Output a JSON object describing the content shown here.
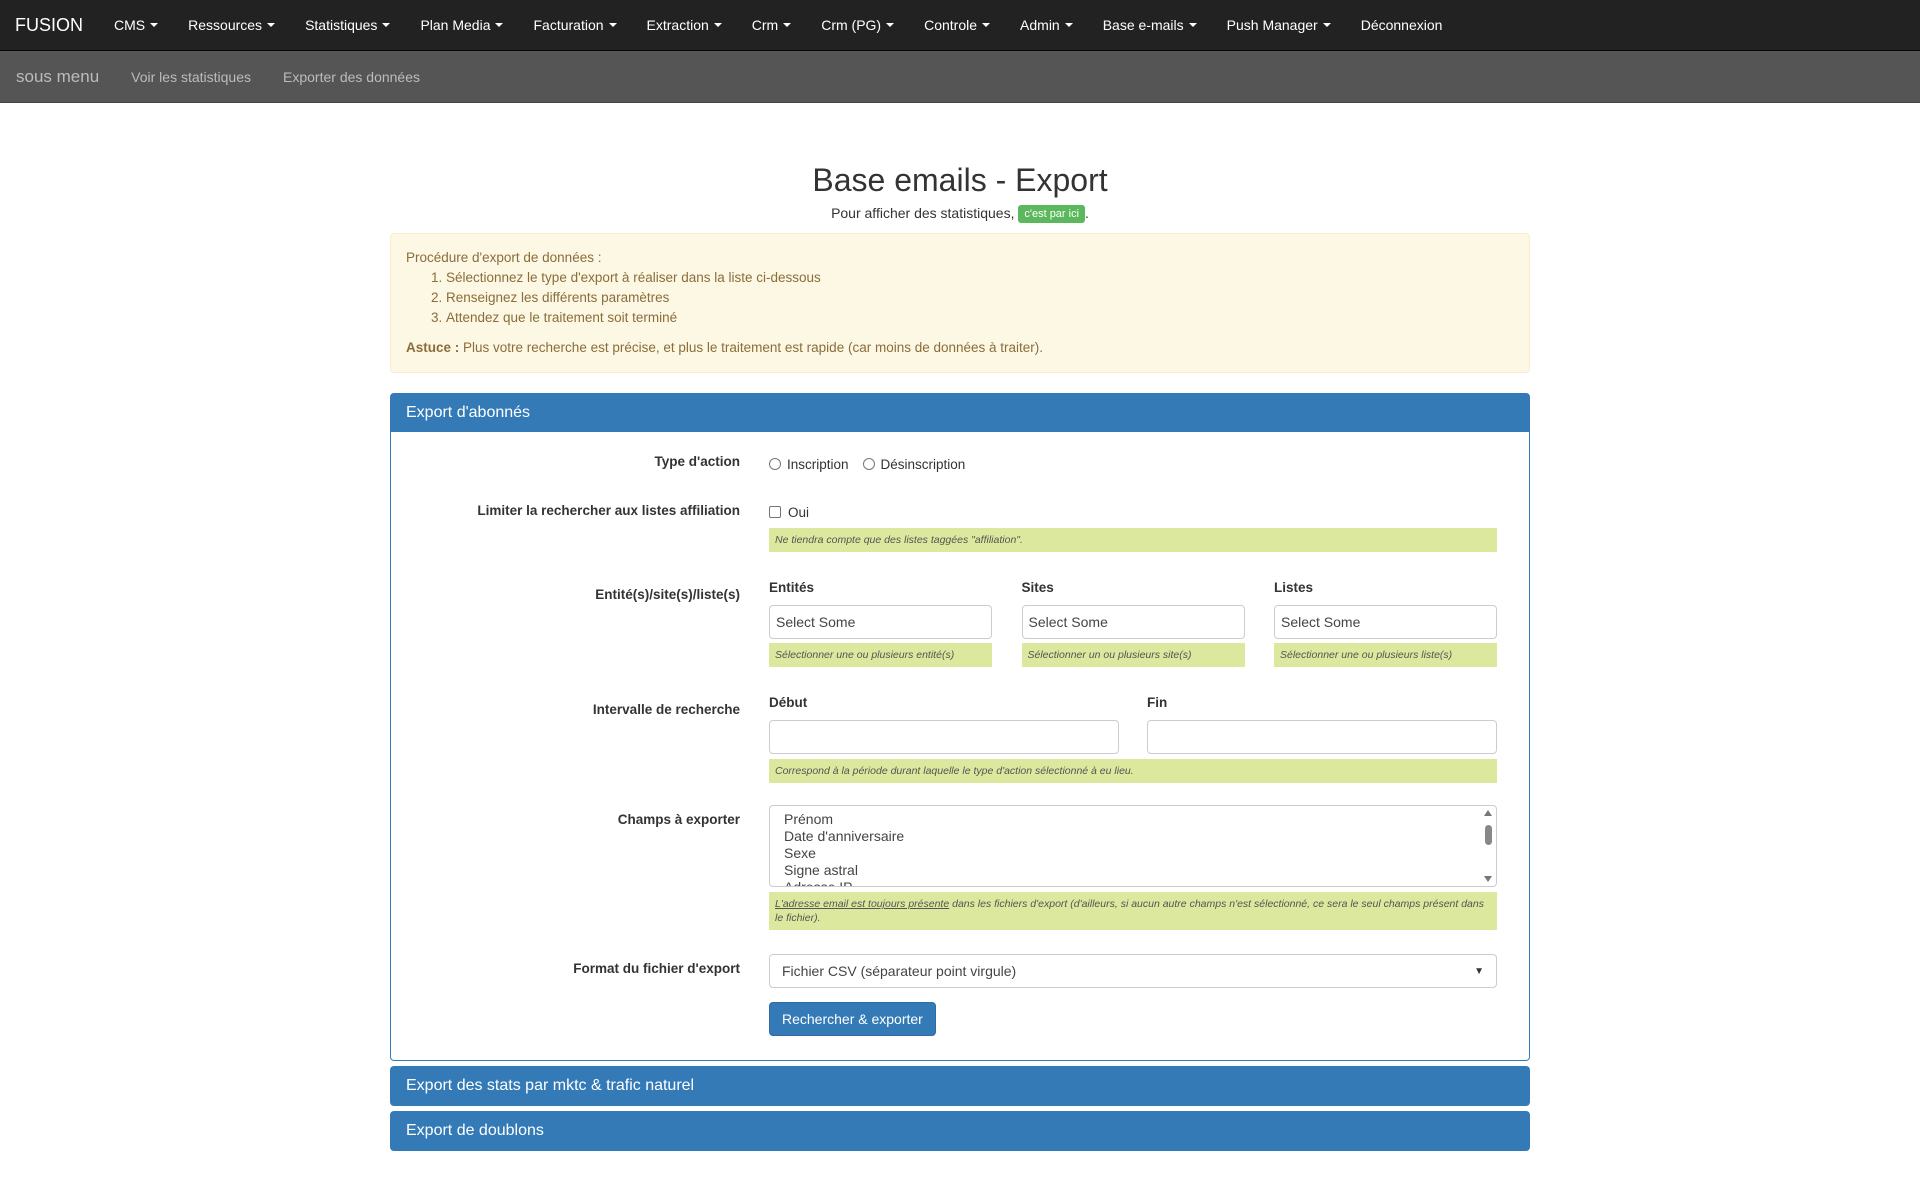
{
  "navbar": {
    "brand": "FUSION",
    "items": [
      {
        "label": "CMS",
        "dropdown": true
      },
      {
        "label": "Ressources",
        "dropdown": true
      },
      {
        "label": "Statistiques",
        "dropdown": true
      },
      {
        "label": "Plan Media",
        "dropdown": true
      },
      {
        "label": "Facturation",
        "dropdown": true
      },
      {
        "label": "Extraction",
        "dropdown": true
      },
      {
        "label": "Crm",
        "dropdown": true
      },
      {
        "label": "Crm (PG)",
        "dropdown": true
      },
      {
        "label": "Controle",
        "dropdown": true
      },
      {
        "label": "Admin",
        "dropdown": true
      },
      {
        "label": "Base e-mails",
        "dropdown": true
      },
      {
        "label": "Push Manager",
        "dropdown": true
      },
      {
        "label": "Déconnexion",
        "dropdown": false
      }
    ]
  },
  "subnav": {
    "title": "sous menu",
    "items": [
      "Voir les statistiques",
      "Exporter des données"
    ]
  },
  "page": {
    "title": "Base emails - Export",
    "intro_text": "Pour afficher des statistiques,",
    "intro_badge": "c'est par ici",
    "intro_suffix": "."
  },
  "alert": {
    "heading": "Procédure d'export de données :",
    "steps": [
      "Sélectionnez le type d'export à réaliser dans la liste ci-dessous",
      "Renseignez les différents paramètres",
      "Attendez que le traitement soit terminé"
    ],
    "tip_label": "Astuce :",
    "tip_text": " Plus votre recherche est précise, et plus le traitement est rapide (car moins de données à traiter)."
  },
  "panel_export": {
    "heading": "Export d'abonnés",
    "action_type": {
      "label": "Type d'action",
      "options": [
        "Inscription",
        "Désinscription"
      ]
    },
    "affiliation": {
      "label": "Limiter la rechercher aux listes affiliation",
      "option": "Oui",
      "help": "Ne tiendra compte que des listes taggées \"affiliation\"."
    },
    "entities": {
      "label": "Entité(s)/site(s)/liste(s)",
      "cols": [
        {
          "title": "Entités",
          "placeholder": "Select Some",
          "help": "Sélectionner une ou plusieurs entité(s)"
        },
        {
          "title": "Sites",
          "placeholder": "Select Some",
          "help": "Sélectionner un ou plusieurs site(s)"
        },
        {
          "title": "Listes",
          "placeholder": "Select Some",
          "help": "Sélectionner une ou plusieurs liste(s)"
        }
      ]
    },
    "interval": {
      "label": "Intervalle de recherche",
      "start_title": "Début",
      "start_value": "",
      "end_title": "Fin",
      "end_value": "",
      "help": "Correspond à la période durant laquelle le type d'action sélectionné à eu lieu."
    },
    "fields": {
      "label": "Champs à exporter",
      "options": [
        "Prénom",
        "Date d'anniversaire",
        "Sexe",
        "Signe astral",
        "Adresse IP"
      ],
      "help_underlined": "L'adresse email est toujours présente",
      "help_rest": " dans les fichiers d'export (d'ailleurs, si aucun autre champs n'est sélectionné, ce sera le seul champs présent dans le fichier)."
    },
    "format": {
      "label": "Format du fichier d'export",
      "selected": "Fichier CSV (séparateur point virgule)"
    },
    "submit_label": "Rechercher & exporter"
  },
  "panel_stats": {
    "heading": "Export des stats par mktc & trafic naturel"
  },
  "panel_doublons": {
    "heading": "Export de doublons"
  }
}
